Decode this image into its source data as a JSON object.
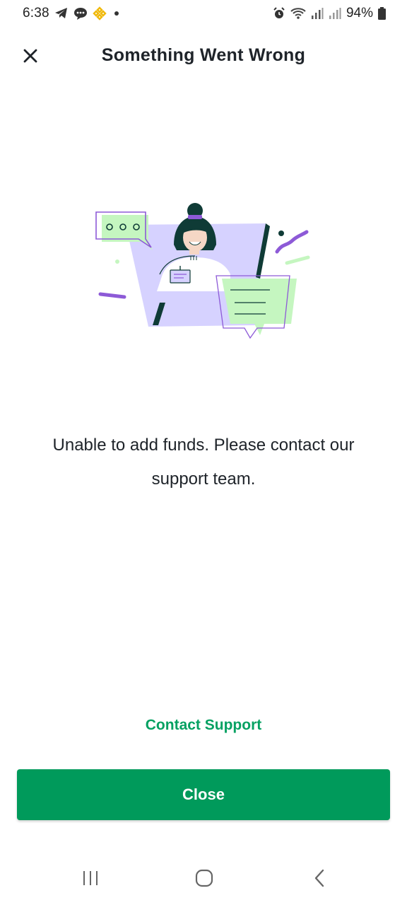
{
  "status_bar": {
    "time": "6:38",
    "battery_percent": "94%",
    "notification_icons": [
      "telegram-icon",
      "chat-icon",
      "binance-icon",
      "dot-icon"
    ],
    "system_icons": [
      "alarm-icon",
      "wifi-icon",
      "signal-icon",
      "signal-icon",
      "battery-icon"
    ]
  },
  "header": {
    "title": "Something Went Wrong",
    "close_icon": "close-icon"
  },
  "illustration": {
    "icon": "support-agent-illustration"
  },
  "message": {
    "text": "Unable to add funds. Please contact our support team."
  },
  "actions": {
    "contact_support_label": "Contact Support",
    "close_label": "Close"
  },
  "nav_bar": {
    "buttons": [
      "recents-icon",
      "home-icon",
      "back-icon"
    ]
  },
  "colors": {
    "accent_green": "#009a5b",
    "link_green": "#05a162",
    "illustration_purple": "#8d5ad7",
    "illustration_lavender": "#d6d2ff",
    "illustration_light_green": "#c5f6c0",
    "text_dark": "#1e2329"
  }
}
